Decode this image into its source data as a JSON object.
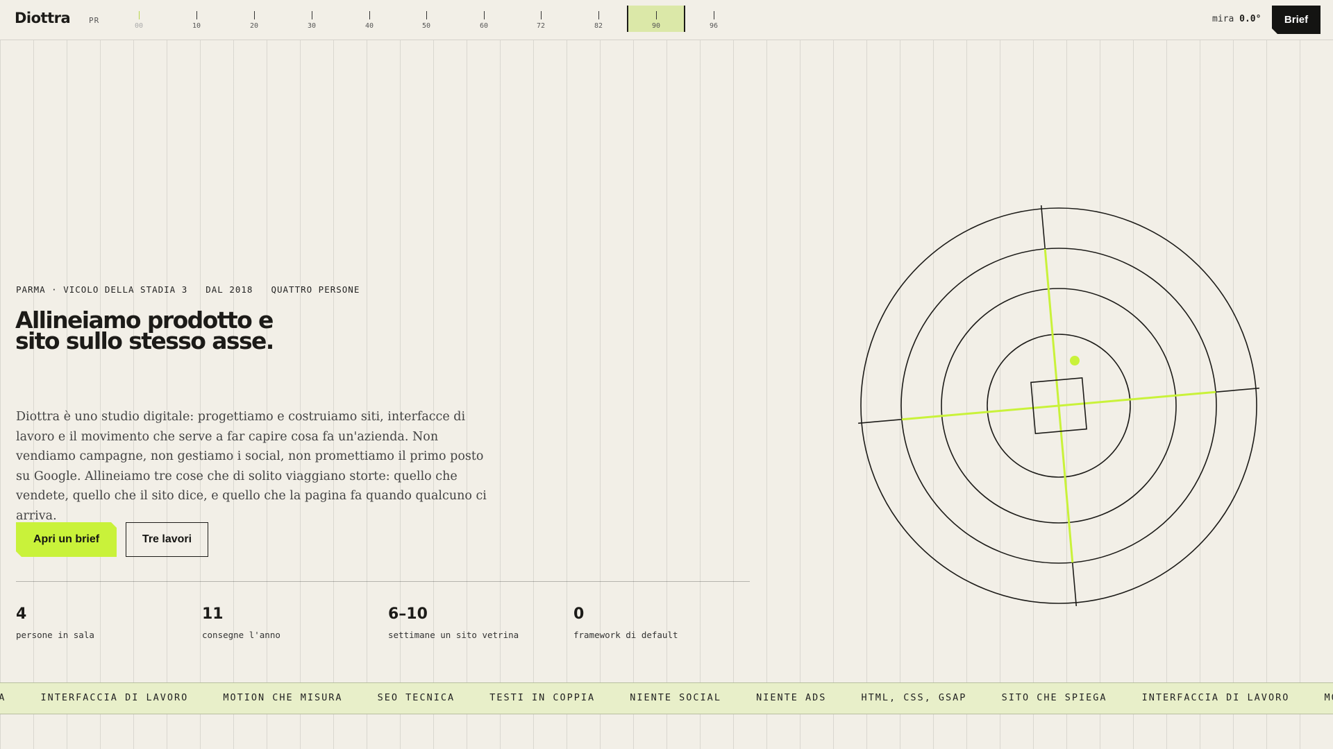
{
  "header": {
    "logo": "Diottra",
    "logo_suffix": "PR",
    "ruler_ticks": [
      "00",
      "10",
      "20",
      "30",
      "40",
      "50",
      "60",
      "72",
      "82",
      "90",
      "96"
    ],
    "active_tick": "90",
    "mira_label": "mira",
    "mira_value": "0.0°",
    "brief_button": "Brief"
  },
  "hero": {
    "meta": [
      "PARMA · VICOLO DELLA STADIA 3",
      "DAL 2018",
      "QUATTRO PERSONE"
    ],
    "headline": "Allineiamo prodotto e sito sullo stesso asse.",
    "body": "Diottra è uno studio digitale: progettiamo e costruiamo siti, interfacce di lavoro e il movimento che serve a far capire cosa fa un'azienda. Non vendiamo campagne, non gestiamo i social, non promettiamo il primo posto su Google. Allineiamo tre cose che di solito viaggiano storte: quello che vendete, quello che il sito dice, e quello che la pagina fa quando qualcuno ci arriva.",
    "cta_primary": "Apri un brief",
    "cta_secondary": "Tre lavori"
  },
  "stats": [
    {
      "value": "4",
      "label": "persone in sala"
    },
    {
      "value": "11",
      "label": "consegne l'anno"
    },
    {
      "value": "6–10",
      "label": "settimane un sito vetrina"
    },
    {
      "value": "0",
      "label": "framework di default"
    }
  ],
  "marquee": [
    "EGA",
    "INTERFACCIA DI LAVORO",
    "MOTION CHE MISURA",
    "SEO TECNICA",
    "TESTI IN COPPIA",
    "NIENTE SOCIAL",
    "NIENTE ADS",
    "HTML, CSS, GSAP",
    "SITO CHE SPIEGA",
    "INTERFACCIA DI LAVORO",
    "MOTION"
  ],
  "colors": {
    "background": "#f2efe7",
    "ink": "#1c1b18",
    "accent": "#c9f23a",
    "marquee_bg": "#e8efc9"
  },
  "icons": {
    "target": "crosshair-target-icon"
  }
}
